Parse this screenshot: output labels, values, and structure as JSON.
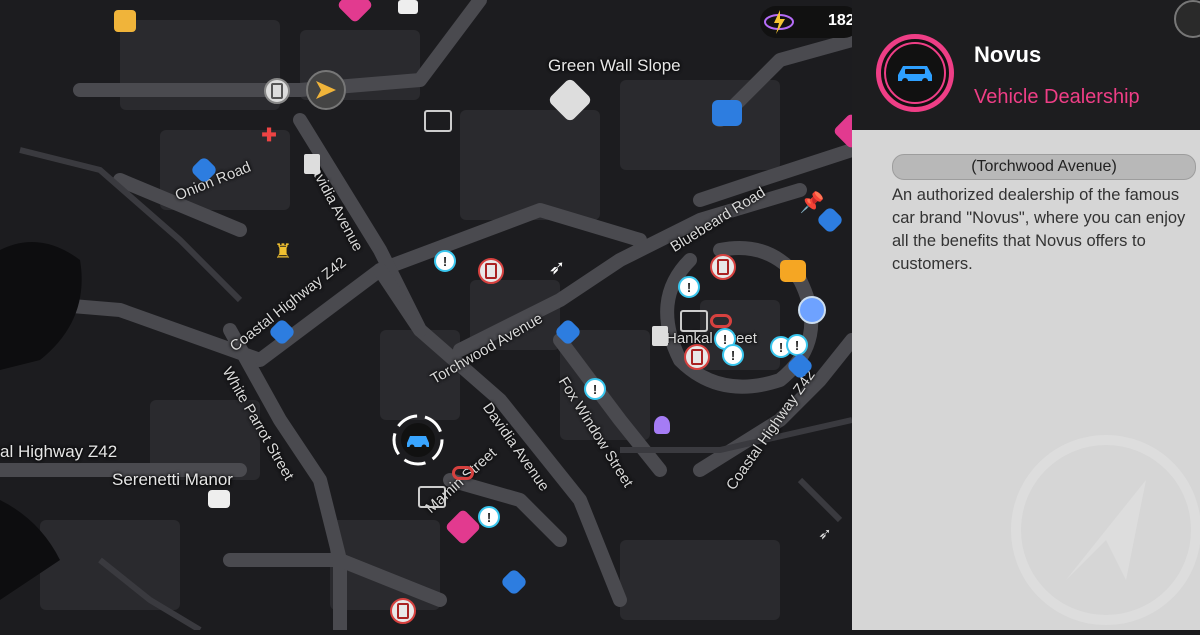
{
  "map": {
    "labels": {
      "green_wall_slope": "Green Wall Slope",
      "onion_road": "Onion Road",
      "davidia_avenue_north": "Davidia Avenue",
      "davidia_avenue_south": "Davidia Avenue",
      "coastal_highway_west": "Coastal Highway Z42",
      "coastal_highway_east": "Coastal Highway Z42",
      "coastal_highway_left": "al Highway Z42",
      "torchwood_avenue": "Torchwood Avenue",
      "white_parrot_street": "White Parrot Street",
      "fox_window_street": "Fox Window Street",
      "bluebeard_road": "Bluebeard Road",
      "hankal_street": "Hankal Street",
      "serenetti_manor": "Serenetti Manor",
      "mamin_street": "Mamin Street"
    }
  },
  "currency": {
    "value": "182"
  },
  "panel": {
    "title": "Novus",
    "subtitle": "Vehicle Dealership",
    "location": "(Torchwood Avenue)",
    "description": "An authorized dealership of the famous car brand \"Novus\", where you can enjoy all the benefits that Novus offers to customers."
  },
  "colors": {
    "accent": "#ef3e86",
    "info": "#39c6ee",
    "road": "#4a4a4f",
    "panel": "#d6d6d6"
  },
  "icons": {
    "car": "car-icon",
    "info": "info-marker-icon",
    "save": "save-point-icon",
    "building": "building-icon",
    "camera": "camera-icon",
    "home": "home-icon",
    "pin": "pushpin-icon"
  }
}
